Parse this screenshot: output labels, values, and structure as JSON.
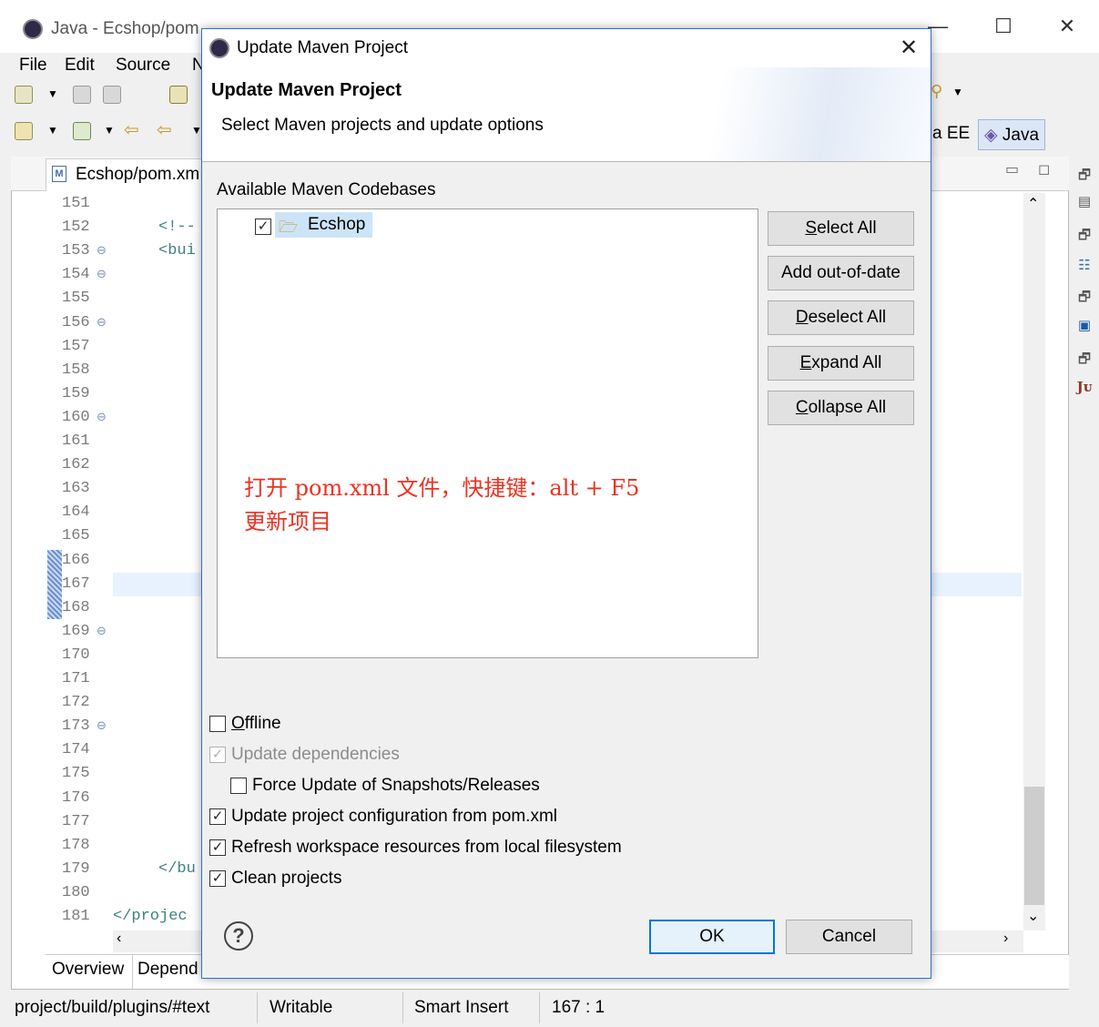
{
  "window": {
    "title": "Java - Ecshop/pom.xml - Eclipse",
    "title_visible": "Java - Ecshop/pom",
    "controls": {
      "minimize": "—",
      "maximize": "☐",
      "close": "✕"
    }
  },
  "menubar": {
    "items": [
      "File",
      "Edit",
      "Source",
      "N"
    ]
  },
  "perspectives": {
    "javaee": "a EE",
    "java": "Java"
  },
  "editor": {
    "tab_label": "Ecshop/pom.xml",
    "tab_label_visible": "Ecshop/pom.xm",
    "lines": [
      {
        "no": "151",
        "fold": "",
        "code": ""
      },
      {
        "no": "152",
        "fold": "",
        "code": "<!--"
      },
      {
        "no": "153",
        "fold": "⊖",
        "code": "<bui"
      },
      {
        "no": "154",
        "fold": "⊖",
        "code": ""
      },
      {
        "no": "155",
        "fold": "",
        "code": ""
      },
      {
        "no": "156",
        "fold": "⊖",
        "code": ""
      },
      {
        "no": "157",
        "fold": "",
        "code": ""
      },
      {
        "no": "158",
        "fold": "",
        "code": ""
      },
      {
        "no": "159",
        "fold": "",
        "code": ""
      },
      {
        "no": "160",
        "fold": "⊖",
        "code": ""
      },
      {
        "no": "161",
        "fold": "",
        "code": ""
      },
      {
        "no": "162",
        "fold": "",
        "code": ""
      },
      {
        "no": "163",
        "fold": "",
        "code": ""
      },
      {
        "no": "164",
        "fold": "",
        "code": ""
      },
      {
        "no": "165",
        "fold": "",
        "code": ""
      },
      {
        "no": "166",
        "fold": "",
        "code": ""
      },
      {
        "no": "167",
        "fold": "",
        "code": ""
      },
      {
        "no": "168",
        "fold": "",
        "code": ""
      },
      {
        "no": "169",
        "fold": "⊖",
        "code": ""
      },
      {
        "no": "170",
        "fold": "",
        "code": ""
      },
      {
        "no": "171",
        "fold": "",
        "code": ""
      },
      {
        "no": "172",
        "fold": "",
        "code": ""
      },
      {
        "no": "173",
        "fold": "⊖",
        "code": ""
      },
      {
        "no": "174",
        "fold": "",
        "code": ""
      },
      {
        "no": "175",
        "fold": "",
        "code": ""
      },
      {
        "no": "176",
        "fold": "",
        "code": ""
      },
      {
        "no": "177",
        "fold": "",
        "code": ""
      },
      {
        "no": "178",
        "fold": "",
        "code": ""
      },
      {
        "no": "179",
        "fold": "",
        "code": "</bu"
      },
      {
        "no": "180",
        "fold": "",
        "code": ""
      },
      {
        "no": "181",
        "fold": "",
        "code": "</projec"
      }
    ],
    "bottom_tabs": [
      "Overview",
      "Depend"
    ]
  },
  "status_bar": {
    "path": "project/build/plugins/#text",
    "writable": "Writable",
    "insert_mode": "Smart Insert",
    "position": "167 : 1"
  },
  "dialog": {
    "title": "Update Maven Project",
    "close": "✕",
    "banner_title": "Update Maven Project",
    "banner_subtitle": "Select Maven projects and update options",
    "section_label": "Available Maven Codebases",
    "tree_item": {
      "label": "Ecshop",
      "checked": true
    },
    "buttons": {
      "select_all": {
        "m": "S",
        "rest": "elect All"
      },
      "add_out_of_date": "Add out-of-date",
      "deselect_all": {
        "m": "D",
        "rest": "eselect All"
      },
      "expand_all": {
        "m": "E",
        "rest": "xpand All"
      },
      "collapse_all": {
        "m": "C",
        "rest": "ollapse All"
      }
    },
    "annotation": {
      "line1": "打开 pom.xml 文件，快捷键：alt + F5",
      "line2": "更新项目"
    },
    "options": {
      "offline": {
        "m": "O",
        "rest": "ffline",
        "checked": false
      },
      "update_dependencies": {
        "label": "Update dependencies",
        "checked": true,
        "disabled": true
      },
      "force_update": {
        "label": "Force Update of Snapshots/Releases",
        "checked": false
      },
      "update_config": {
        "label": "Update project configuration from pom.xml",
        "checked": true
      },
      "refresh_workspace": {
        "label": "Refresh workspace resources from local filesystem",
        "checked": true
      },
      "clean_projects": {
        "label": "Clean projects",
        "checked": true
      }
    },
    "help": "?",
    "ok": "OK",
    "cancel": "Cancel"
  },
  "colors": {
    "accent": "#0078d7",
    "annotation": "#ea3323",
    "selection": "#cce4f7"
  }
}
